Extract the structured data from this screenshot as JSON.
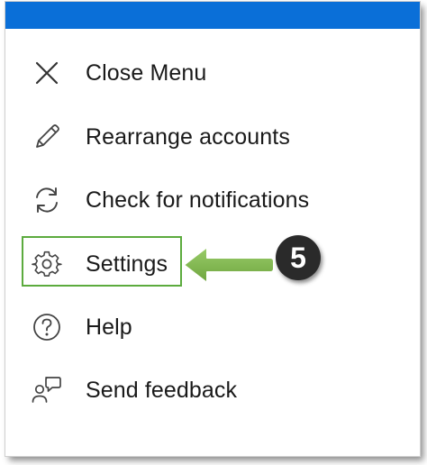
{
  "menu": {
    "items": [
      {
        "label": "Close Menu",
        "icon": "close-icon"
      },
      {
        "label": "Rearrange accounts",
        "icon": "pencil-icon"
      },
      {
        "label": "Check for notifications",
        "icon": "refresh-icon"
      },
      {
        "label": "Settings",
        "icon": "gear-icon"
      },
      {
        "label": "Help",
        "icon": "help-icon"
      },
      {
        "label": "Send feedback",
        "icon": "feedback-icon"
      }
    ]
  },
  "annotation": {
    "step_number": "5",
    "highlight_color": "#5cab3e",
    "arrow_color": "#7ab648"
  },
  "colors": {
    "accent": "#0a6fd8",
    "text": "#1a1a1a"
  }
}
